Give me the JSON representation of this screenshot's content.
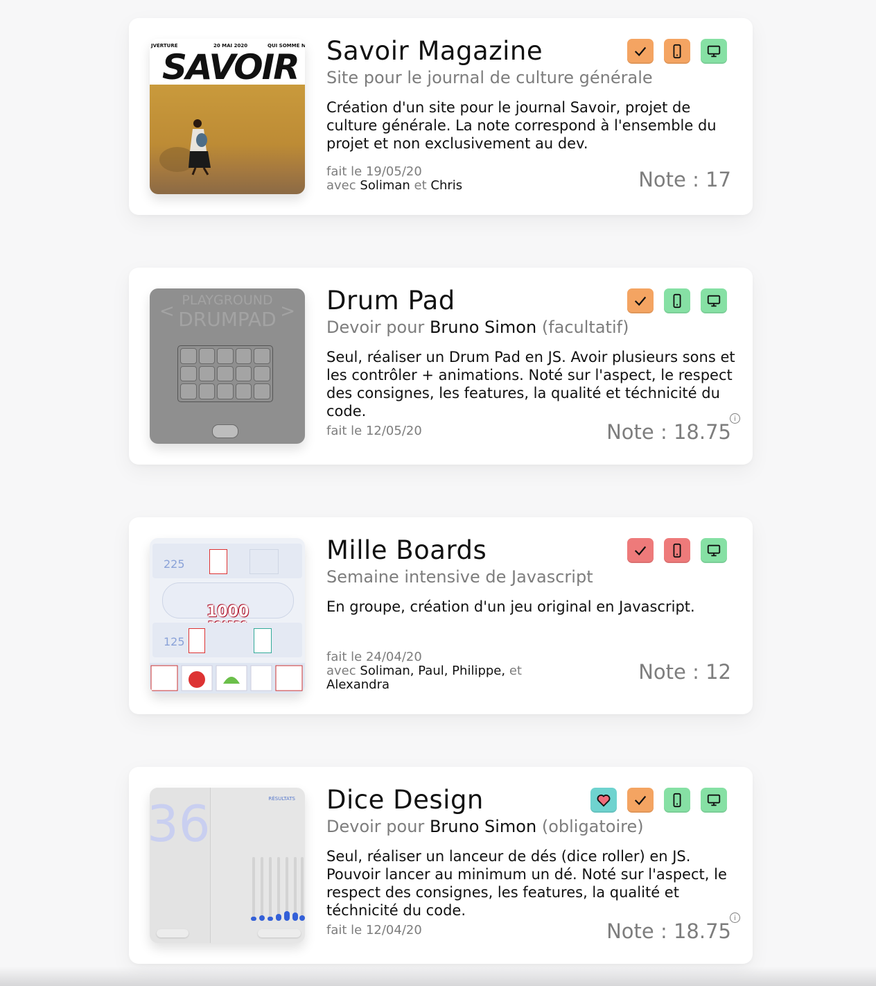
{
  "projects": [
    {
      "title": "Savoir Magazine",
      "subtitle": "Site pour le journal de culture générale",
      "description": "Création d'un site pour le journal Savoir, projet de culture générale. La note correspond à l'ensemble du projet et non exclusivement au dev.",
      "date_label": "fait le 19/05/20",
      "with_label": "avec",
      "collaborators_a": "Soliman",
      "conj": "et",
      "collaborators_b": "Chris",
      "note": "Note : 17",
      "badges": [
        "check-orange",
        "phone-orange",
        "desktop-green"
      ],
      "thumb": {
        "nav_left": "JVERTURE",
        "nav_mid": "20 MAI 2020",
        "nav_right": "QUI SOMME N",
        "masthead": "SAVOIR"
      }
    },
    {
      "title": "Drum Pad",
      "subtitle_prefix": "Devoir pour",
      "subtitle_name": "Bruno Simon",
      "subtitle_suffix": "(facultatif)",
      "description": "Seul, réaliser un Drum Pad en JS. Avoir plusieurs sons et les contrôler + animations. Noté sur l'aspect, le respect des consignes, les features, la qualité et téchnicité du code.",
      "date_label": "fait le 12/05/20",
      "note": "Note : 18.75",
      "info": "i",
      "badges": [
        "check-orange",
        "phone-green",
        "desktop-green"
      ],
      "thumb": {
        "line1": "PLAYGROUND",
        "line2": "DRUMPAD"
      }
    },
    {
      "title": "Mille Boards",
      "subtitle": "Semaine intensive de Javascript",
      "description": "En groupe, création d'un jeu original en Javascript.",
      "date_label": "fait le 24/04/20",
      "with_label": "avec",
      "collaborators_a": "Soliman, Paul, Philippe,",
      "conj": "et",
      "collaborators_b": "Alexandra",
      "note": "Note : 12",
      "badges": [
        "check-red",
        "phone-red",
        "desktop-green"
      ],
      "thumb": {
        "logo_line1": "1000",
        "logo_line2": "BOARDS",
        "num1": "225",
        "num2": "125"
      }
    },
    {
      "title": "Dice Design",
      "subtitle_prefix": "Devoir pour",
      "subtitle_name": "Bruno Simon",
      "subtitle_suffix": "(obligatoire)",
      "description": "Seul, réaliser un lanceur de dés (dice roller) en JS. Pouvoir lancer au minimum un dé. Noté sur l'aspect, le respect des consignes, les features, la qualité et téchnicité du code.",
      "date_label": "fait le 12/04/20",
      "note": "Note : 18.75",
      "info": "i",
      "badges": [
        "heart-teal",
        "check-orange",
        "phone-green",
        "desktop-green"
      ],
      "thumb": {
        "big": "36",
        "heading": "RÉSULTATS"
      }
    }
  ],
  "colors": {
    "orange": "#f4a462",
    "green": "#86e0a4",
    "red": "#ee7a7a",
    "teal": "#6fd3cf"
  }
}
